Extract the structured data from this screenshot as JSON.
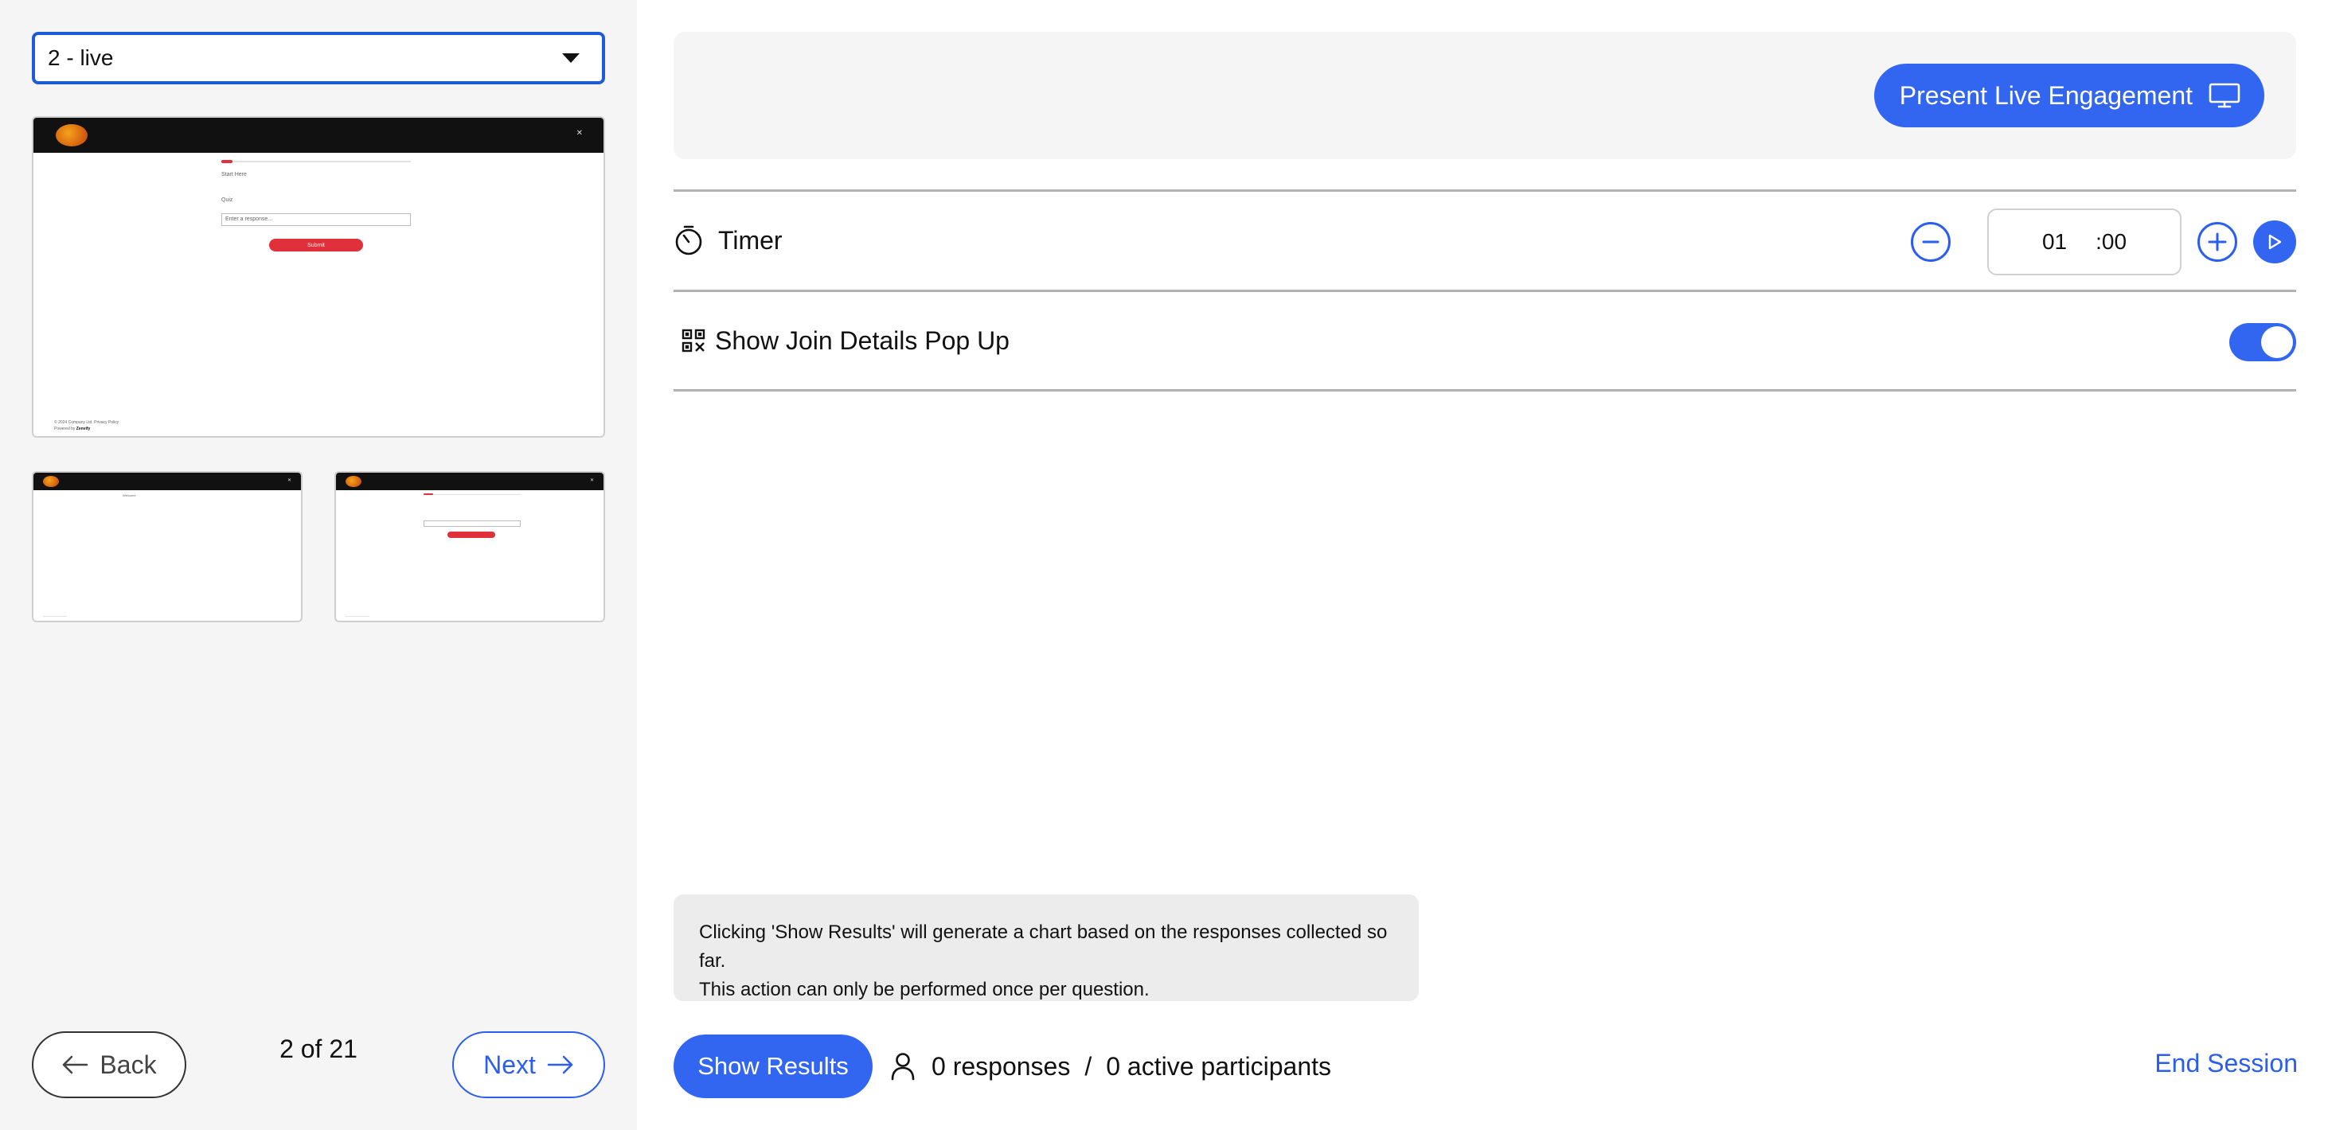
{
  "sidebar": {
    "slide_select": {
      "value": "2 - live"
    },
    "thumbnails": {
      "main": {
        "field_label_1": "Start Here",
        "field_label_2": "Quiz",
        "input_placeholder": "Enter a response...",
        "submit_label": "Submit",
        "footer_line_1": "© 2024 Company Ltd. Privacy Policy",
        "footer_line_2": "Powered by",
        "footer_brand": "Zenvify"
      },
      "small_a": {
        "caption": "Welcome"
      }
    },
    "nav": {
      "back_label": "Back",
      "next_label": "Next",
      "page_count": "2 of 21"
    }
  },
  "main": {
    "present_label": "Present Live Engagement",
    "timer": {
      "label": "Timer",
      "minutes": "01",
      "seconds": ":00"
    },
    "join_popup": {
      "label": "Show Join Details Pop Up",
      "enabled": true
    },
    "info": {
      "line_1": "Clicking 'Show Results' will generate a chart based on the responses collected so far.",
      "line_2": "This action can only be performed once per question."
    },
    "footer": {
      "show_results_label": "Show Results",
      "responses": "0 responses",
      "separator": "/",
      "participants": "0 active participants",
      "end_session_label": "End Session"
    }
  },
  "colors": {
    "accent": "#3366f0",
    "select_border": "#1f5bd6",
    "sidebar_bg": "#f5f5f5",
    "info_bg": "#ececec",
    "thumb_header": "#111111",
    "thumb_button": "#e0303a"
  },
  "icons": {
    "select_caret": "chevron-down-icon",
    "back": "arrow-left-icon",
    "next": "arrow-right-icon",
    "present": "monitor-icon",
    "timer": "stopwatch-icon",
    "minus": "minus-circle-icon",
    "plus": "plus-circle-icon",
    "play": "play-icon",
    "join": "qr-code-icon",
    "participants": "user-icon"
  }
}
